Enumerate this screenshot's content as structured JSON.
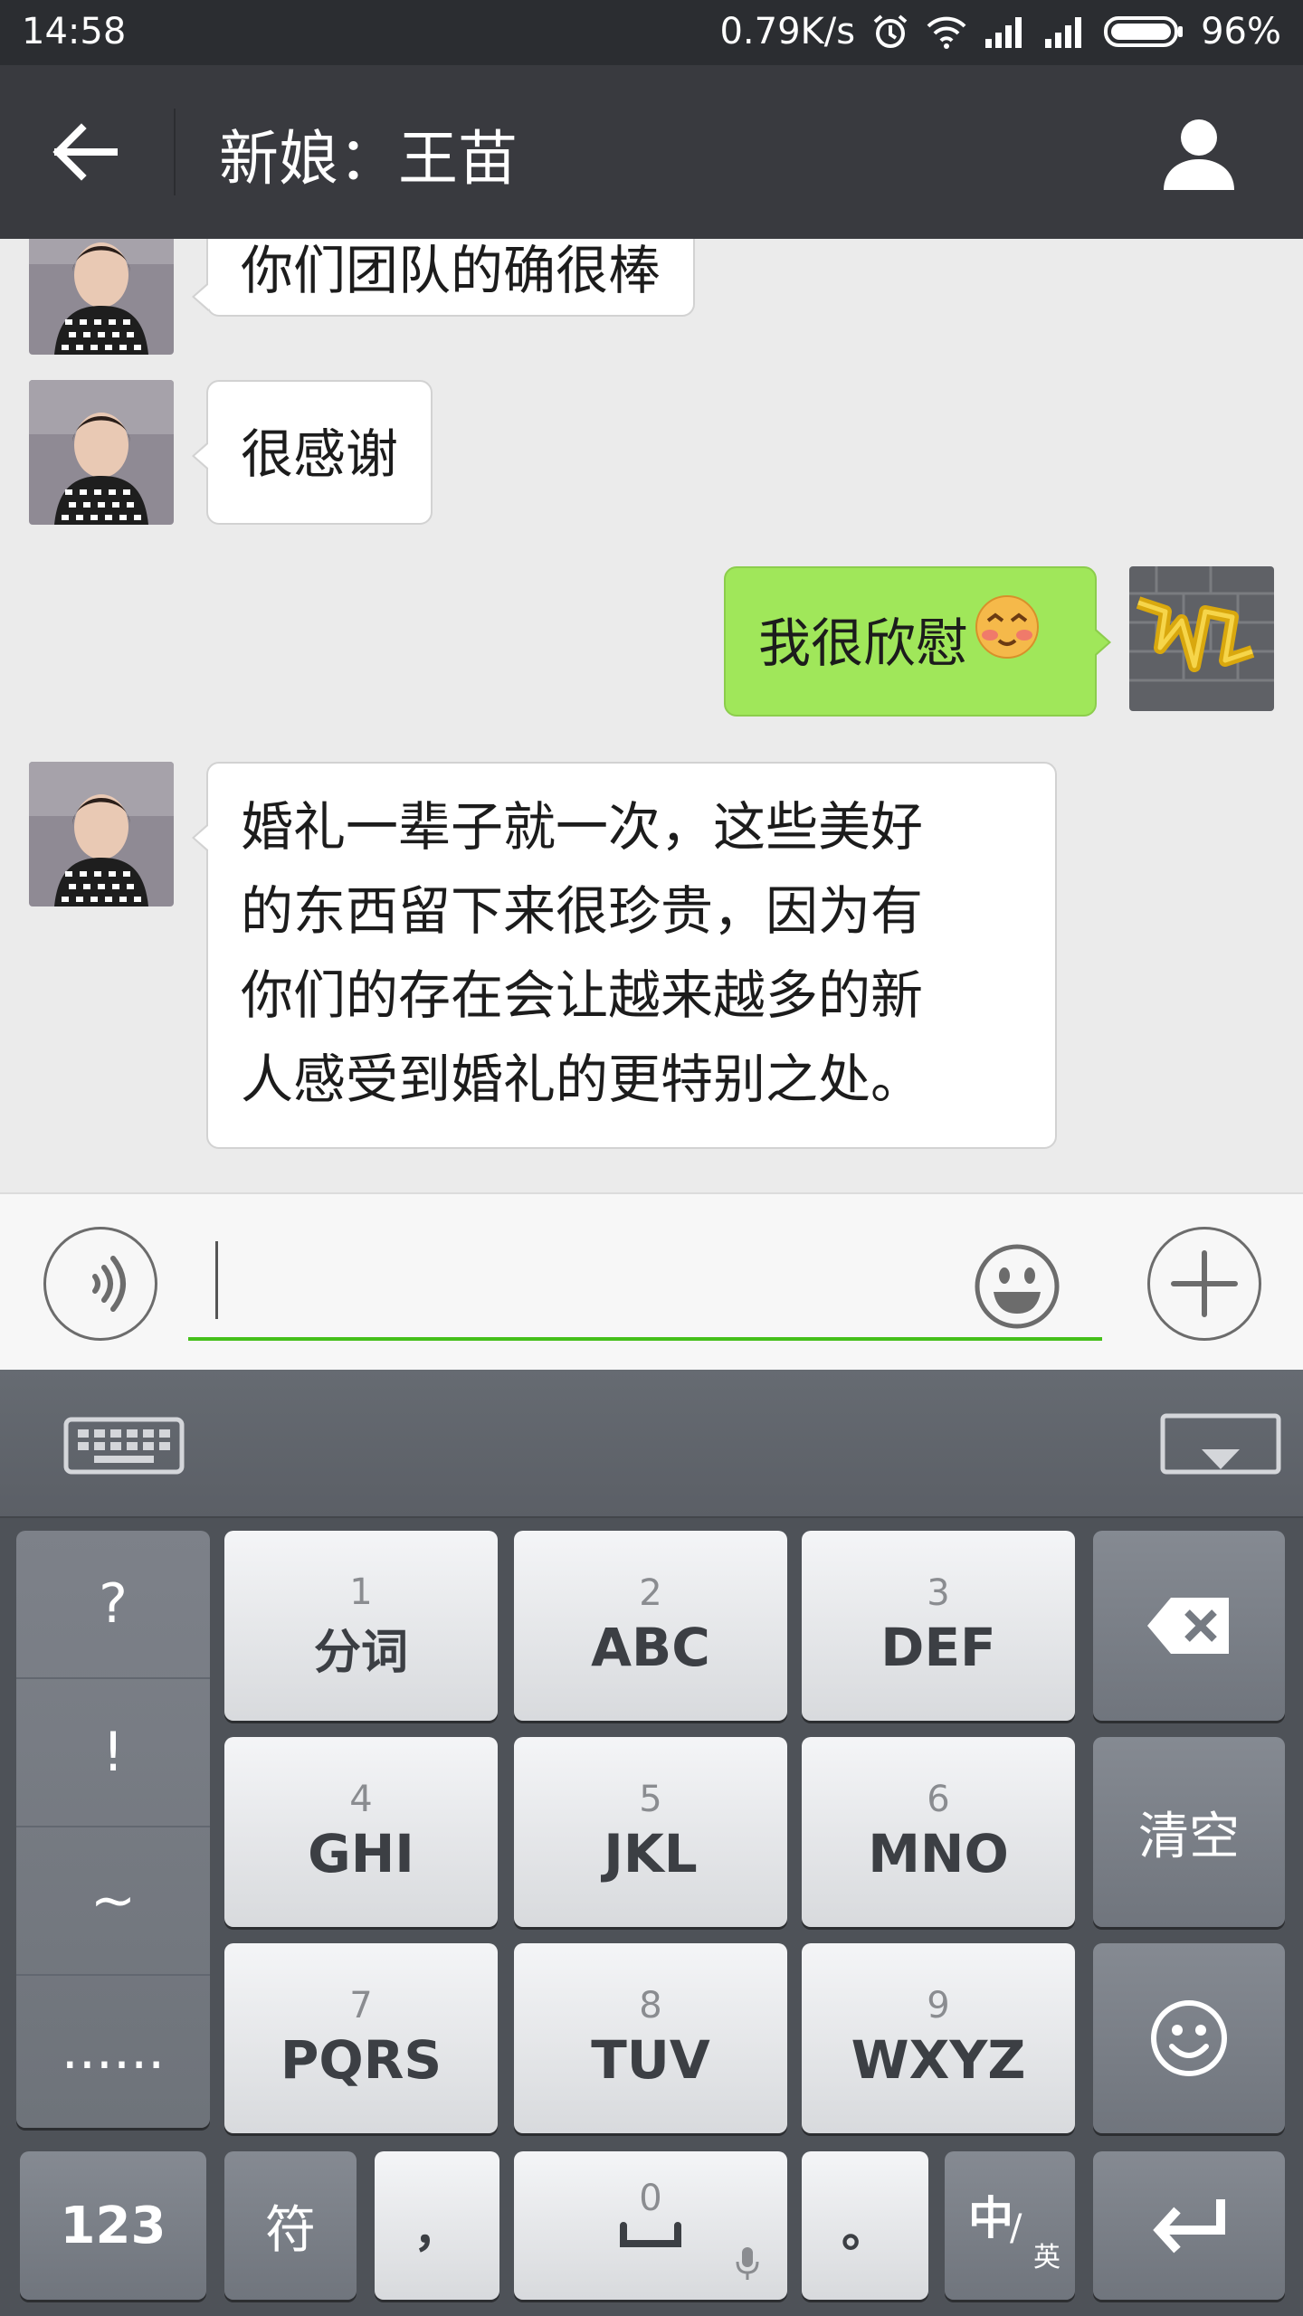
{
  "status_bar": {
    "time": "14:58",
    "net_speed": "0.79K/s",
    "battery": "96%"
  },
  "header": {
    "title": "新娘：王苗"
  },
  "messages": [
    {
      "side": "left",
      "text_lines": [
        "你们团队的确很棒"
      ]
    },
    {
      "side": "left",
      "text_lines": [
        "很感谢"
      ]
    },
    {
      "side": "right",
      "text_lines": [
        "我很欣慰"
      ],
      "emoji": "blushing-face"
    },
    {
      "side": "left",
      "text_lines": [
        "婚礼一辈子就一次，这些美好",
        "的东西留下来很珍贵，因为有",
        "你们的存在会让越来越多的新",
        "人感受到婚礼的更特别之处。"
      ]
    }
  ],
  "composer": {
    "value": "",
    "accent_color": "#45c01a"
  },
  "keyboard": {
    "punct": [
      "?",
      "!",
      "~",
      "......"
    ],
    "keys": [
      {
        "num": "1",
        "label": "分词"
      },
      {
        "num": "2",
        "label": "ABC"
      },
      {
        "num": "3",
        "label": "DEF"
      },
      {
        "num": "4",
        "label": "GHI"
      },
      {
        "num": "5",
        "label": "JKL"
      },
      {
        "num": "6",
        "label": "MNO"
      },
      {
        "num": "7",
        "label": "PQRS"
      },
      {
        "num": "8",
        "label": "TUV"
      },
      {
        "num": "9",
        "label": "WXYZ"
      }
    ],
    "clear_label": "清空",
    "bottom": {
      "num_mode": "123",
      "symbol": "符",
      "comma": "，",
      "space_num": "0",
      "period": "。",
      "lang_main": "中",
      "lang_sub": "英"
    }
  }
}
